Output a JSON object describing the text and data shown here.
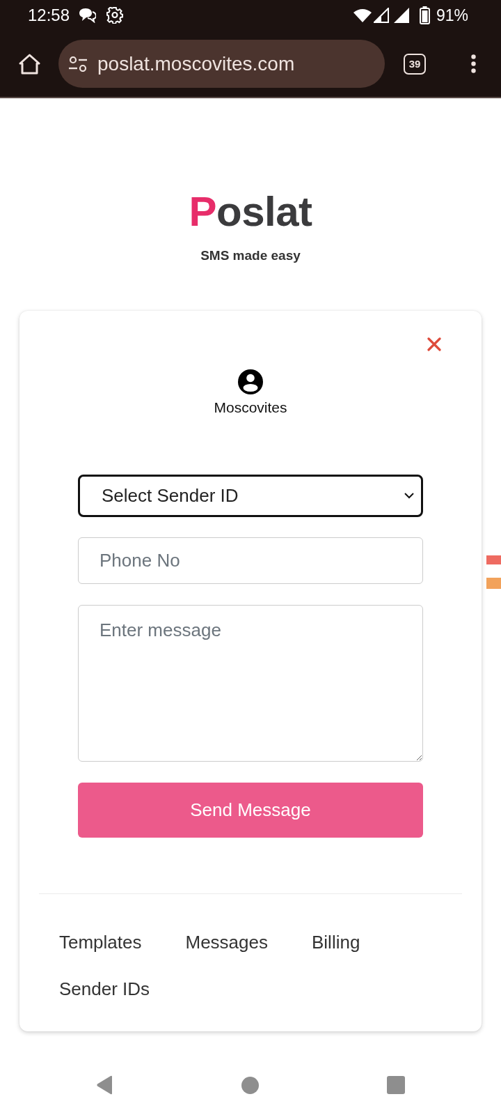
{
  "status_bar": {
    "time": "12:58",
    "battery": "91%"
  },
  "browser_bar": {
    "url": "poslat.moscovites.com",
    "tab_count": "39"
  },
  "header": {
    "logo": "Poslat",
    "tagline": "SMS made easy"
  },
  "card": {
    "account_name": "Moscovites",
    "sender_select": {
      "value": "Select Sender ID",
      "focused": true
    },
    "phone_field": {
      "placeholder": "Phone No"
    },
    "message_field": {
      "placeholder": "Enter message"
    },
    "send_button": "Send Message",
    "links": [
      "Templates",
      "Messages",
      "Billing",
      "Sender IDs"
    ]
  }
}
